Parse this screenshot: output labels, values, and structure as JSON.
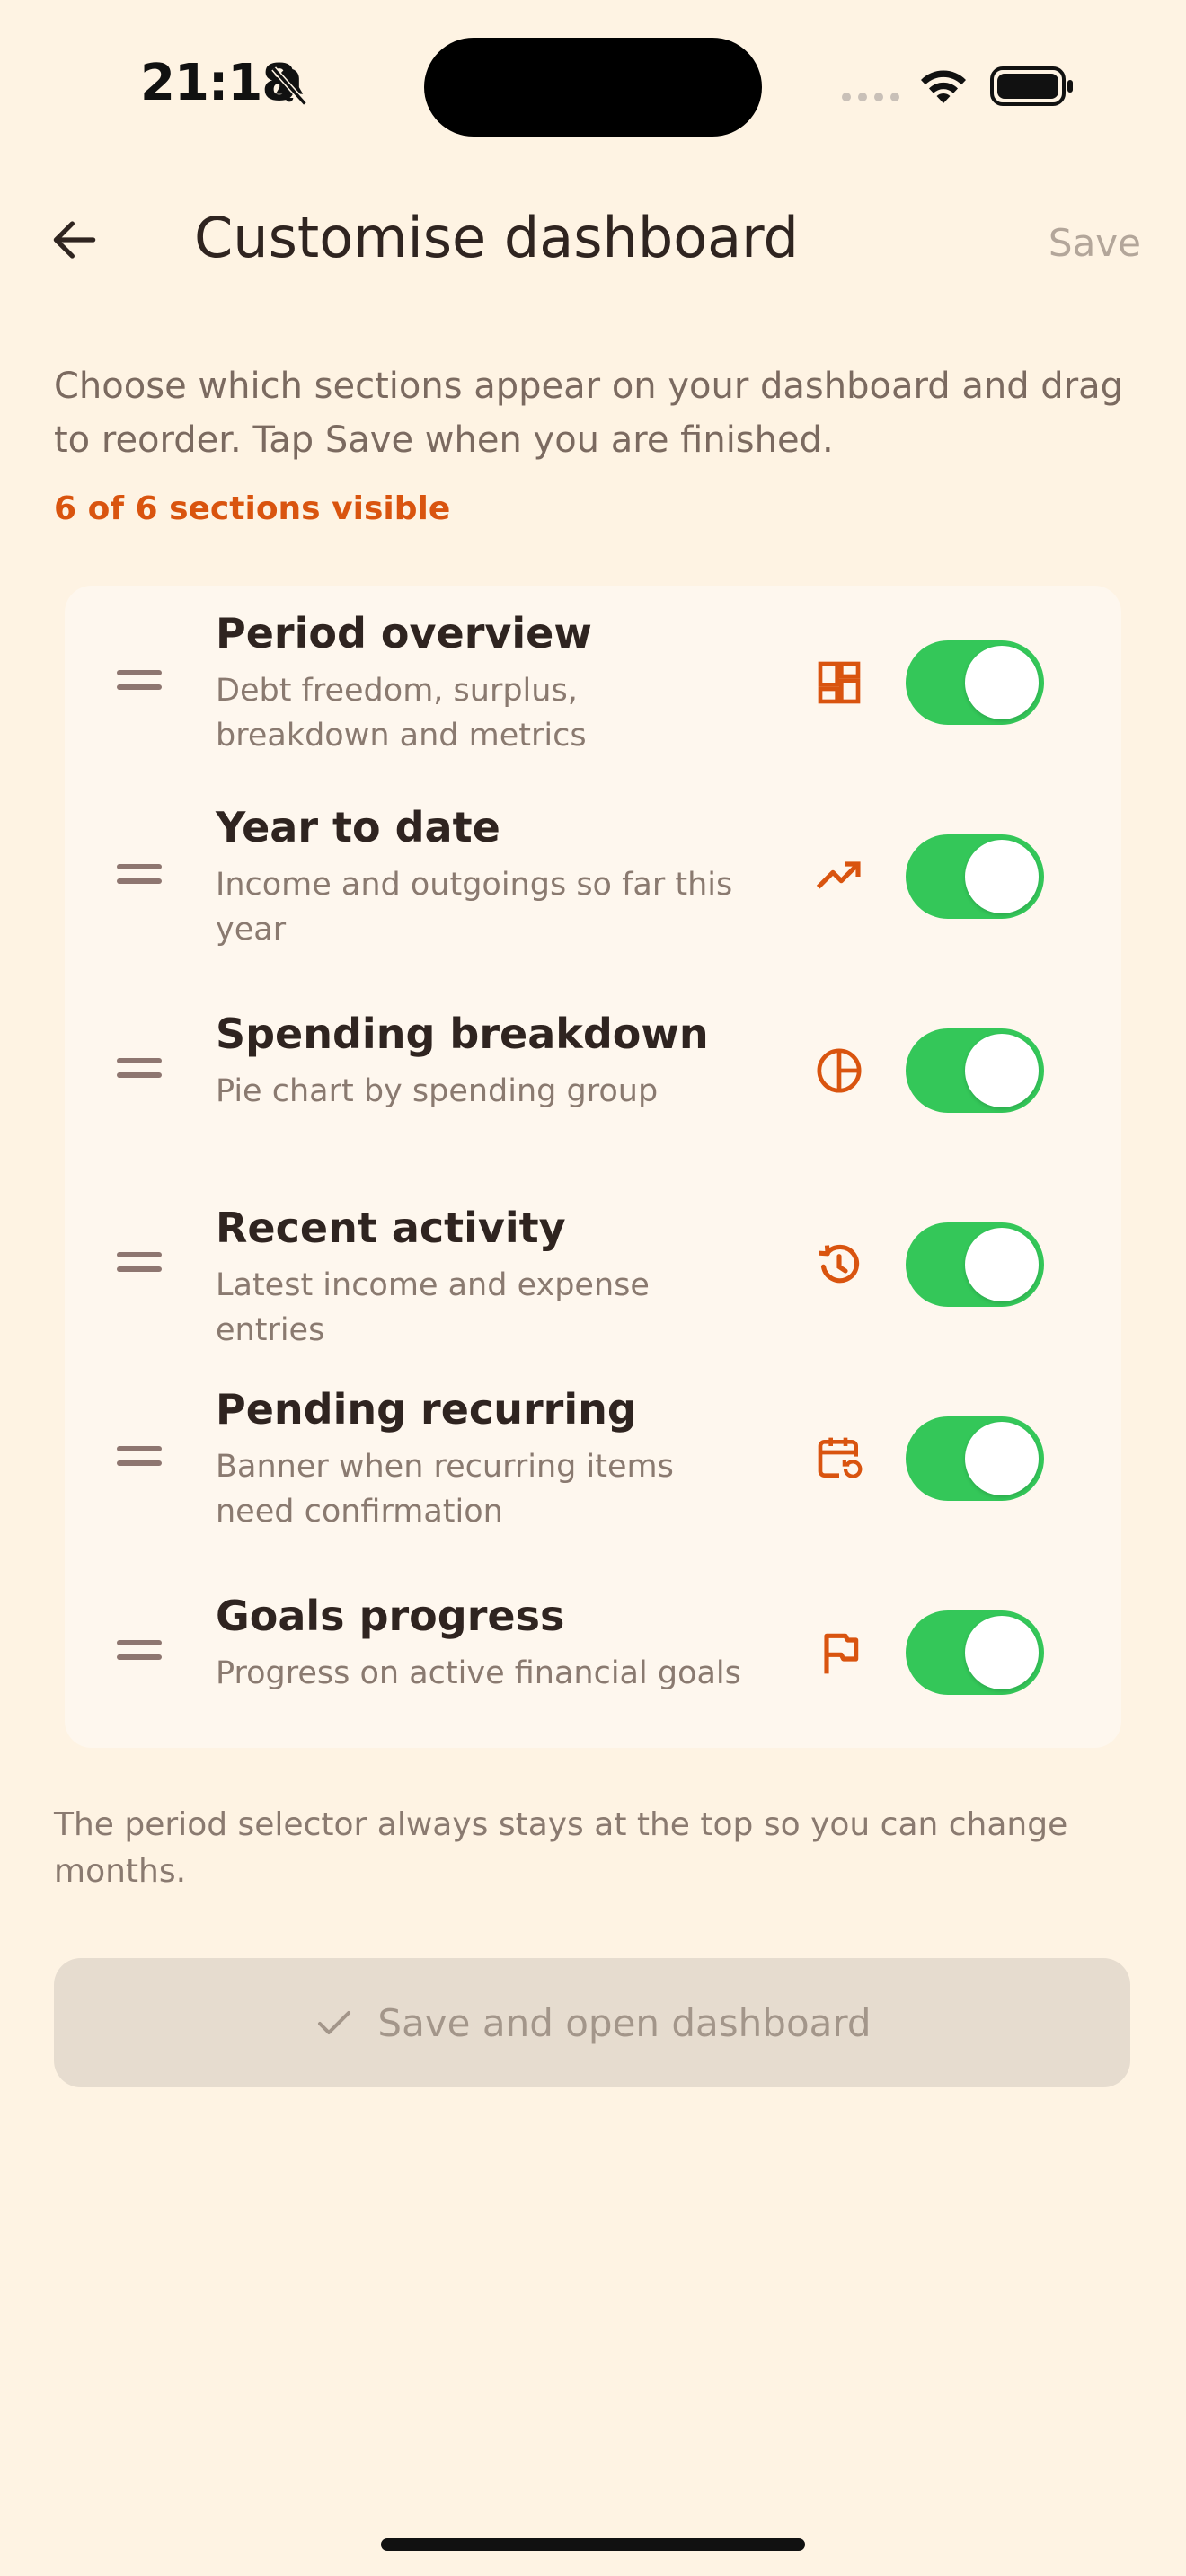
{
  "status_bar": {
    "time": "21:18",
    "icons": [
      "bell-slash-icon",
      "cellular-signal-icon",
      "wifi-icon",
      "battery-icon"
    ]
  },
  "header": {
    "title": "Customise dashboard",
    "save_label": "Save",
    "back_icon": "arrow-left-icon"
  },
  "description": "Choose which sections appear on your dashboard and drag to reorder. Tap Save when you are finished.",
  "visible_count": "6 of 6 sections visible",
  "sections": [
    {
      "title": "Period overview",
      "subtitle": "Debt freedom, surplus, breakdown and metrics",
      "icon": "dashboard-grid-icon",
      "enabled": true
    },
    {
      "title": "Year to date",
      "subtitle": "Income and outgoings so far this year",
      "icon": "trending-up-icon",
      "enabled": true
    },
    {
      "title": "Spending breakdown",
      "subtitle": "Pie chart by spending group",
      "icon": "pie-chart-icon",
      "enabled": true
    },
    {
      "title": "Recent activity",
      "subtitle": "Latest income and expense entries",
      "icon": "history-icon",
      "enabled": true
    },
    {
      "title": "Pending recurring",
      "subtitle": "Banner when recurring items need confirmation",
      "icon": "calendar-repeat-icon",
      "enabled": true
    },
    {
      "title": "Goals progress",
      "subtitle": "Progress on active financial goals",
      "icon": "flag-icon",
      "enabled": true
    }
  ],
  "footnote": "The period selector always stays at the top so you can change months.",
  "primary_button": {
    "label": "Save and open dashboard",
    "icon": "check-icon"
  },
  "colors": {
    "background": "#FEF3E3",
    "card": "#FEF7EE",
    "accent": "#D9540F",
    "toggle_on": "#34C759",
    "button_disabled": "#E6DCCF"
  }
}
